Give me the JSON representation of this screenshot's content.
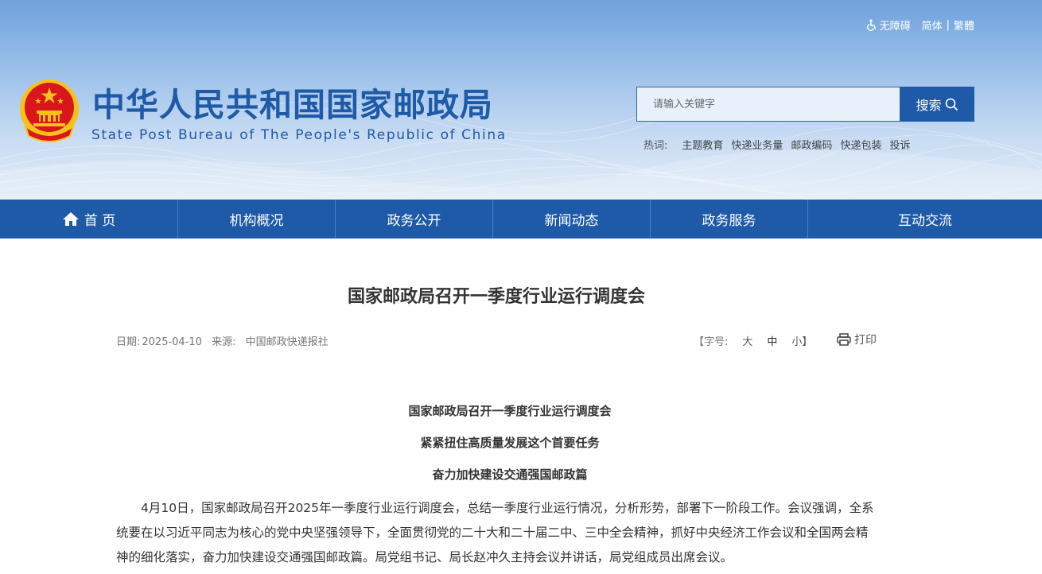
{
  "header": {
    "accessibility": "无障碍",
    "lang_simplified": "简体",
    "lang_divider": "|",
    "lang_traditional": "繁體",
    "site_title": "中华人民共和国国家邮政局",
    "site_subtitle": "State Post Bureau of The People's Republic of China"
  },
  "search": {
    "placeholder": "请输入关键字",
    "button_label": "搜索",
    "hot_label": "热词:",
    "hot_words": [
      "主题教育",
      "快递业务量",
      "邮政编码",
      "快递包装",
      "投诉"
    ]
  },
  "nav": {
    "items": [
      "首 页",
      "机构概况",
      "政务公开",
      "新闻动态",
      "政务服务",
      "互动交流"
    ]
  },
  "article": {
    "title": "国家邮政局召开一季度行业运行调度会",
    "date_label": "日期:",
    "date": "2025-04-10",
    "source_label": "来源:",
    "source": "中国邮政快递报社",
    "fontsize_open": "【字号:",
    "fontsize_large": "大",
    "fontsize_medium": "中",
    "fontsize_small": "小】",
    "print_label": "打印",
    "subheads": [
      "国家邮政局召开一季度行业运行调度会",
      "紧紧扭住高质量发展这个首要任务",
      "奋力加快建设交通强国邮政篇"
    ],
    "paragraph": "4月10日，国家邮政局召开2025年一季度行业运行调度会，总结一季度行业运行情况，分析形势，部署下一阶段工作。会议强调，全系统要在以习近平同志为核心的党中央坚强领导下，全面贯彻党的二十大和二十届二中、三中全会精神，抓好中央经济工作会议和全国两会精神的细化落实，奋力加快建设交通强国邮政篇。局党组书记、局长赵冲久主持会议并讲话，局党组成员出席会议。"
  },
  "colors": {
    "primary": "#1f5aa8",
    "title_blue": "#1e5aa6",
    "emblem_red": "#d8161b",
    "emblem_gold": "#f4c21b"
  }
}
